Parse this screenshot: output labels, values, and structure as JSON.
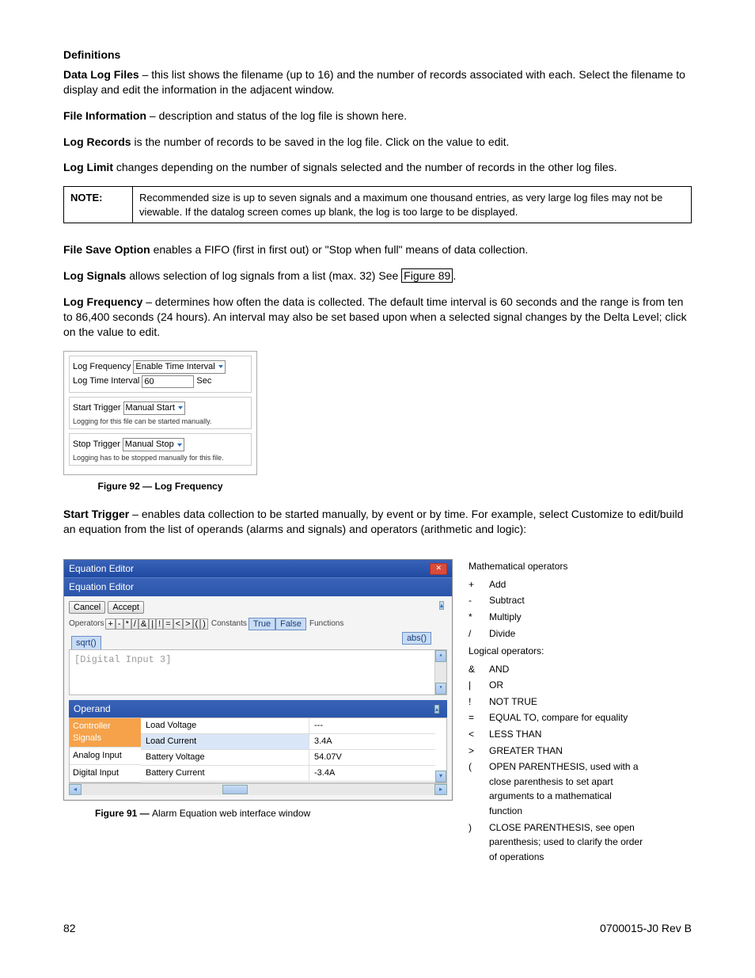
{
  "definitions_heading": "Definitions",
  "paras": {
    "data_log_files_term": "Data Log Files",
    "data_log_files_body": " – this list shows the filename (up to 16) and the number of records associated with each. Select the filename to display and edit the information in the adjacent window.",
    "file_information_term": "File Information",
    "file_information_body": " – description and status of the log file is shown here.",
    "log_records_term": "Log Records",
    "log_records_body": " is the number of records to be saved in the log file. Click on the value to edit.",
    "log_limit_term": "Log Limit",
    "log_limit_body": " changes depending on the number of signals selected and the number of records in the other log files.",
    "file_save_option_term": "File Save Option",
    "file_save_option_body": " enables a FIFO (first in first out) or \"Stop when full\" means of data collection.",
    "log_signals_term": "Log Signals",
    "log_signals_body_before_ref": " allows selection of log signals from a list (max. 32) See ",
    "log_signals_ref": "Figure 89",
    "log_signals_body_after_ref": ".",
    "log_frequency_term": "Log Frequency",
    "log_frequency_body": " – determines how often the data is collected. The default time interval is 60 seconds and the range is from ten to 86,400 seconds (24 hours). An interval may also be set based upon when a selected signal changes by the Delta Level; click on the value to edit.",
    "start_trigger_term": "Start Trigger",
    "start_trigger_body": " – enables data collection to be started manually, by event or by time. For example, select Customize to edit/build an equation from the list of operands (alarms and signals) and operators (arithmetic and logic):"
  },
  "note": {
    "label": "NOTE:",
    "text": "Recommended size is up to seven signals and a maximum one thousand entries, as very large log files may not be viewable. If the datalog screen comes up blank, the log is too large to be displayed."
  },
  "logfreq": {
    "lf_label": "Log Frequency",
    "lf_value": "Enable Time Interval",
    "lti_label": "Log Time Interval",
    "lti_value": "60",
    "lti_unit": "Sec",
    "start_label": "Start Trigger",
    "start_value": "Manual Start",
    "start_note": "Logging for this file can be started manually.",
    "stop_label": "Stop Trigger",
    "stop_value": "Manual Stop",
    "stop_note": "Logging has to be stopped manually for this file.",
    "caption": "Figure 92  —  Log Frequency"
  },
  "eq": {
    "titlebar": "Equation Editor",
    "subtitle": "Equation Editor",
    "cancel": "Cancel",
    "accept": "Accept",
    "operators_label": "Operators",
    "operators": [
      "+",
      "-",
      "*",
      "/",
      "&",
      "|",
      "!",
      "=",
      "<",
      ">",
      "(",
      ")"
    ],
    "constants_label": "Constants",
    "constants": [
      "True",
      "False"
    ],
    "functions_label": "Functions",
    "functions": [
      "abs()",
      "sqrt()"
    ],
    "expression": "[Digital Input 3]",
    "operand_header": "Operand",
    "tabs": {
      "controller_signals": "Controller Signals",
      "analog_input": "Analog Input",
      "digital_input": "Digital Input"
    },
    "signals": [
      {
        "name": "Load Voltage",
        "value": "---"
      },
      {
        "name": "Load Current",
        "value": "3.4A"
      },
      {
        "name": "Battery Voltage",
        "value": "54.07V"
      },
      {
        "name": "Battery Current",
        "value": "-3.4A"
      }
    ],
    "caption_prefix": "Figure 91  —  ",
    "caption_text": "Alarm Equation web interface window"
  },
  "ops_legend": {
    "math_header": "Mathematical operators",
    "math": [
      {
        "sym": "+",
        "desc": "Add"
      },
      {
        "sym": "-",
        "desc": "Subtract"
      },
      {
        "sym": "*",
        "desc": "Multiply"
      },
      {
        "sym": "/",
        "desc": "Divide"
      }
    ],
    "logic_header": "Logical operators:",
    "logic": [
      {
        "sym": "&",
        "desc": "AND"
      },
      {
        "sym": "|",
        "desc": "OR"
      },
      {
        "sym": "!",
        "desc": "NOT TRUE"
      },
      {
        "sym": "=",
        "desc": "EQUAL TO, compare for equality"
      },
      {
        "sym": "<",
        "desc": "LESS THAN"
      },
      {
        "sym": ">",
        "desc": "GREATER THAN"
      },
      {
        "sym": "(",
        "desc": "OPEN PARENTHESIS, used with a close parenthesis to set apart arguments to a mathematical function"
      },
      {
        "sym": ")",
        "desc": "CLOSE PARENTHESIS, see open parenthesis; used to clarify the order of operations"
      }
    ]
  },
  "footer": {
    "page": "82",
    "doc": "0700015-J0    Rev B"
  }
}
